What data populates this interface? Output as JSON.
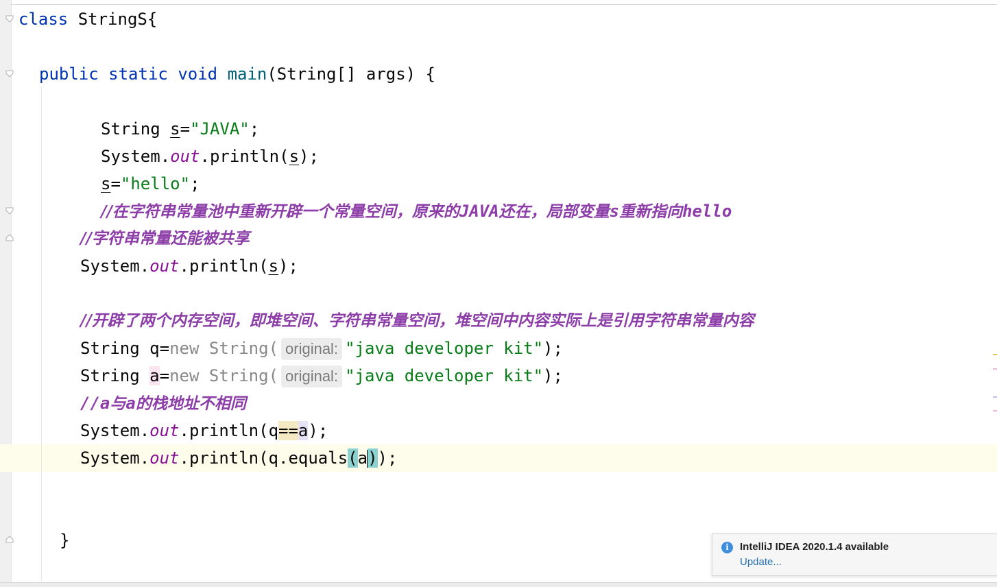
{
  "editor": {
    "class_decl": {
      "kw": "class",
      "name": "StringS{"
    },
    "main_decl": {
      "kw1": "public",
      "kw2": "static",
      "kw3": "void",
      "name": "main",
      "params": "(String[] args) {"
    },
    "l_string_s": {
      "type": "String",
      "var": "s",
      "eq": "=",
      "str": "\"JAVA\"",
      "end": ";"
    },
    "l_println1": {
      "pre": "System.",
      "field": "out",
      "mid": ".println(",
      "arg": "s",
      "end": ");"
    },
    "l_assign": {
      "var": "s",
      "eq": "=",
      "str": "\"hello\"",
      "end": ";"
    },
    "comment1": {
      "p1": "//在字符串常量池中重新开辟一个常量空间，原来的",
      "p2": "JAVA",
      "p3": "还在，局部变量",
      "p4": "s",
      "p5": "重新指向",
      "p6": "hello"
    },
    "comment2": "//字符串常量还能被共享",
    "l_println2": {
      "pre": "System.",
      "field": "out",
      "mid": ".println(",
      "arg": "s",
      "end": ");"
    },
    "comment3": "//开辟了两个内存空间，即堆空间、字符串常量空间，堆空间中内容实际上是引用字符串常量内容",
    "l_new_q": {
      "type": "String ",
      "var": "q",
      "eq": "=",
      "new": "new",
      "ctor": " String(",
      "hint": "original:",
      "str": "\"java developer kit\"",
      "end": ");"
    },
    "l_new_a": {
      "type": "String ",
      "var": "a",
      "eq": "=",
      "new": "new",
      "ctor": " String(",
      "hint": "original:",
      "str": "\"java developer kit\"",
      "end": ");"
    },
    "comment4": {
      "p1": "//",
      "p2": "a",
      "p3": "与",
      "p4": "a",
      "p5": "的栈地址不相同"
    },
    "l_println3": {
      "pre": "System.",
      "field": "out",
      "mid": ".println(",
      "a1": "q",
      "op": "==",
      "a2": "a",
      "end": ");"
    },
    "l_println4": {
      "pre": "System.",
      "field": "out",
      "mid": ".println(q.equals",
      "lp": "(",
      "arg": "a",
      "rp": ")",
      "end": ");"
    },
    "close_brace": "}"
  },
  "notification": {
    "icon": "info-icon",
    "icon_glyph": "i",
    "title": "IntelliJ IDEA 2020.1.4 available",
    "link": "Update..."
  },
  "colors": {
    "keyword": "#0033b3",
    "string": "#067d17",
    "static_field": "#871094",
    "comment": "#8c3da8",
    "current_line": "#fefcea",
    "brace_match": "#8ad1cf"
  }
}
